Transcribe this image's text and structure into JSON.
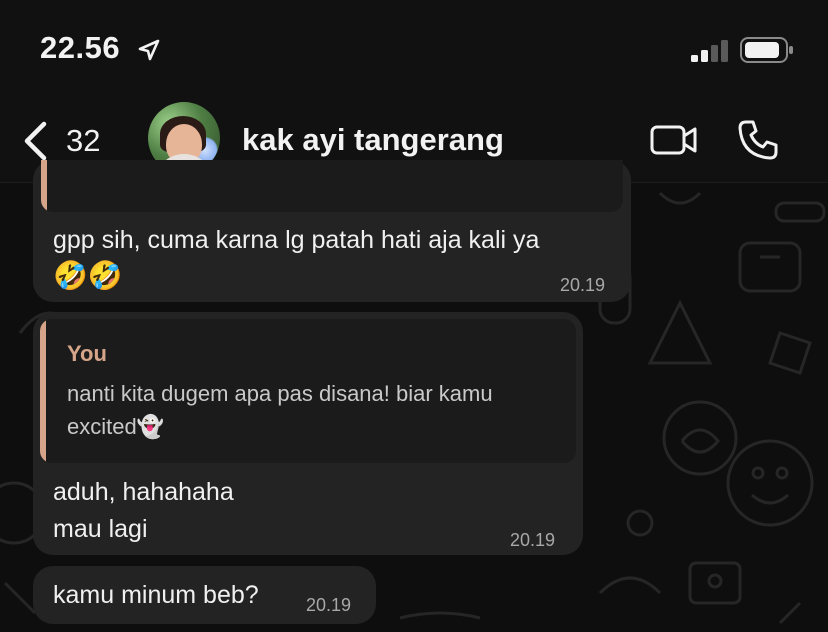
{
  "status_bar": {
    "time": "22.56",
    "location_icon": "location-arrow-icon",
    "signal_icon": "cellular-signal-icon",
    "battery_icon": "battery-icon"
  },
  "header": {
    "back_count": "32",
    "back_icon": "chevron-left-icon",
    "contact_name": "kak ayi tangerang",
    "video_icon": "video-camera-icon",
    "call_icon": "phone-icon"
  },
  "messages": [
    {
      "text": "gpp sih, cuma karna lg patah hati aja kali ya",
      "emoji": "🤣🤣",
      "time": "20.19"
    },
    {
      "quote_author": "You",
      "quote_text": "nanti kita dugem apa pas disana! biar kamu excited👻",
      "line1": "aduh, hahahaha",
      "line2": "mau lagi",
      "time": "20.19"
    },
    {
      "text": "kamu minum beb?",
      "time": "20.19"
    }
  ],
  "colors": {
    "background": "#0e0e0e",
    "bubble": "#232323",
    "quote_accent": "#d6a589",
    "timestamp": "#a8a8a8"
  }
}
